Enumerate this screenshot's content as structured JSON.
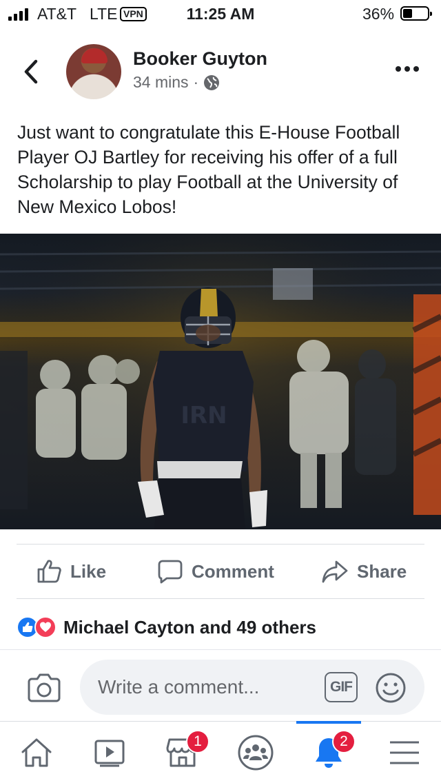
{
  "status_bar": {
    "carrier": "AT&T",
    "network": "LTE",
    "vpn": "VPN",
    "time": "11:25 AM",
    "battery_percent": "36%",
    "battery_level": 0.36,
    "signal_bars": 4
  },
  "post": {
    "author": "Booker Guyton",
    "time_ago": "34 mins",
    "separator": "·",
    "audience_icon": "globe-icon",
    "text": "Just want to congratulate this E-House Football Player OJ Bartley for receiving his offer of a full Scholarship to play Football at the University of New Mexico Lobos!"
  },
  "actions": {
    "like_label": "Like",
    "comment_label": "Comment",
    "share_label": "Share"
  },
  "reactions": {
    "summary": "Michael Cayton and 49 others",
    "types": [
      "like",
      "love"
    ]
  },
  "composer": {
    "placeholder": "Write a comment...",
    "gif_label": "GIF"
  },
  "tabbar": {
    "tabs": [
      {
        "name": "home",
        "icon": "home-icon",
        "badge": ""
      },
      {
        "name": "watch",
        "icon": "video-icon",
        "badge": ""
      },
      {
        "name": "marketplace",
        "icon": "marketplace-icon",
        "badge": "1"
      },
      {
        "name": "groups",
        "icon": "groups-icon",
        "badge": ""
      },
      {
        "name": "notifications",
        "icon": "bell-icon",
        "badge": "2"
      },
      {
        "name": "menu",
        "icon": "menu-icon",
        "badge": ""
      }
    ],
    "active_tab": "notifications"
  },
  "colors": {
    "brand_blue": "#1877f2",
    "badge_red": "#e41e3f",
    "love_red": "#f33e58",
    "muted_text": "#606770"
  }
}
